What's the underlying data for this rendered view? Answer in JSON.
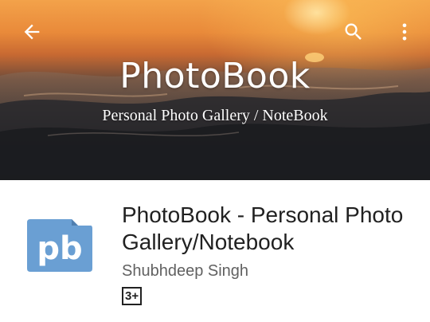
{
  "header": {
    "banner_title": "PhotoBook",
    "banner_subtitle": "Personal Photo Gallery / NoteBook",
    "back_icon": "arrow-back-icon",
    "search_icon": "search-icon",
    "menu_icon": "more-vert-icon"
  },
  "app": {
    "title": "PhotoBook - Personal Photo Gallery/Notebook",
    "developer": "Shubhdeep Singh",
    "content_rating": "3+",
    "icon_text": "pb"
  },
  "colors": {
    "icon_fill": "#6a9fd3",
    "icon_fold": "#4f7fb0",
    "text_primary": "#212121",
    "text_secondary": "#616161"
  }
}
